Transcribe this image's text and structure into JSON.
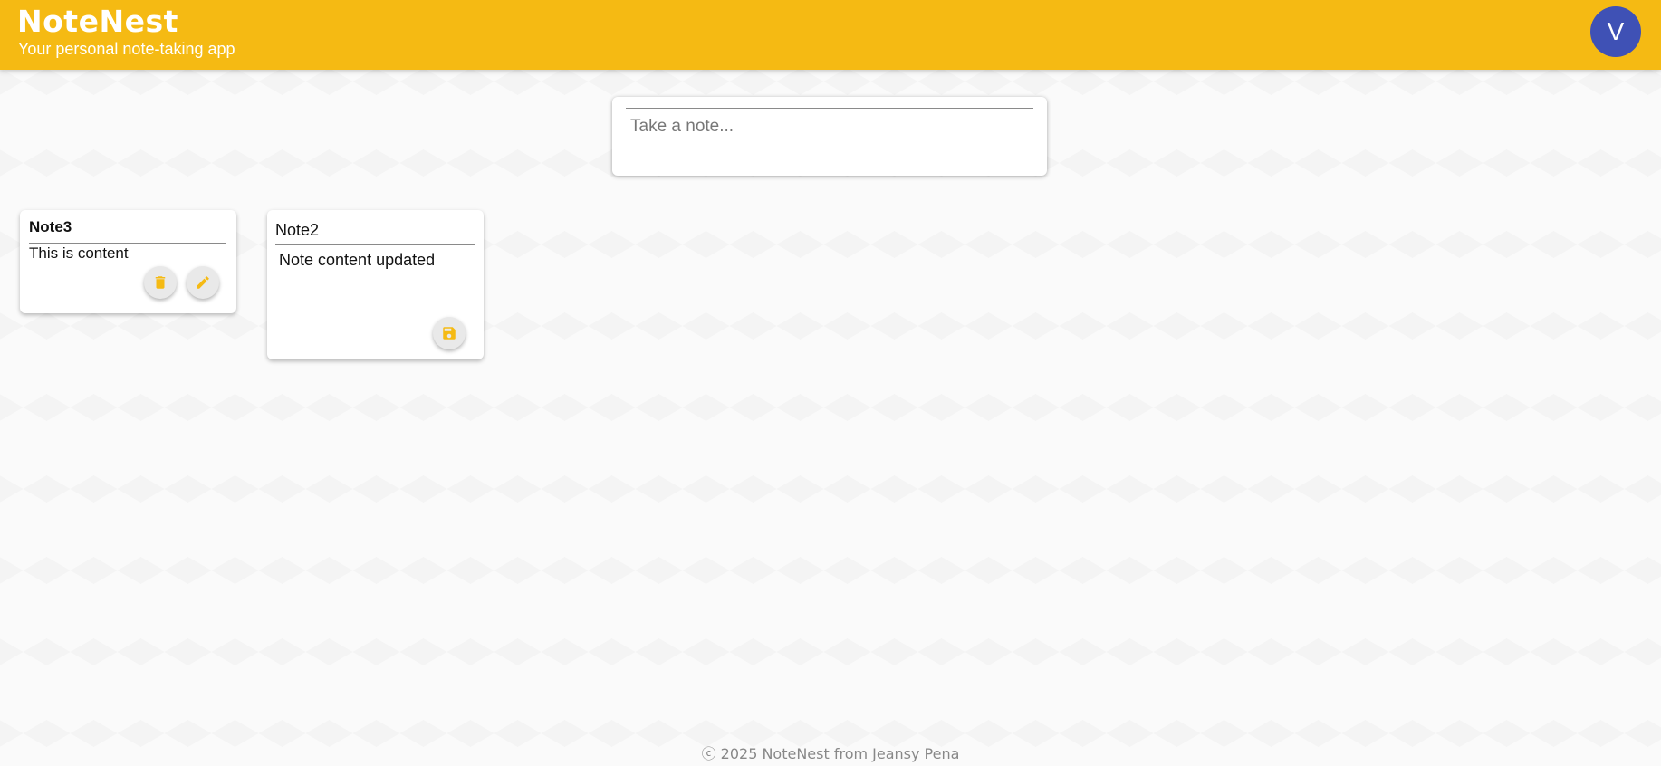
{
  "header": {
    "title": "NoteNest",
    "subtitle": "Your personal note-taking app",
    "avatar_letter": "V"
  },
  "create_note": {
    "content_placeholder": "Take a note..."
  },
  "notes": [
    {
      "title": "Note3",
      "content": "This is content",
      "mode": "view",
      "actions": [
        "trash-icon",
        "pencil-icon"
      ]
    },
    {
      "title": "Note2",
      "content": "Note content updated",
      "mode": "edit",
      "actions": [
        "save-icon"
      ]
    }
  ],
  "footer": {
    "text": "ⓒ 2025 NoteNest from Jeansy Pena"
  },
  "colors": {
    "header_bg": "#f5ba13",
    "avatar_bg": "#3f51b5",
    "icon_color": "#f5ba13"
  }
}
